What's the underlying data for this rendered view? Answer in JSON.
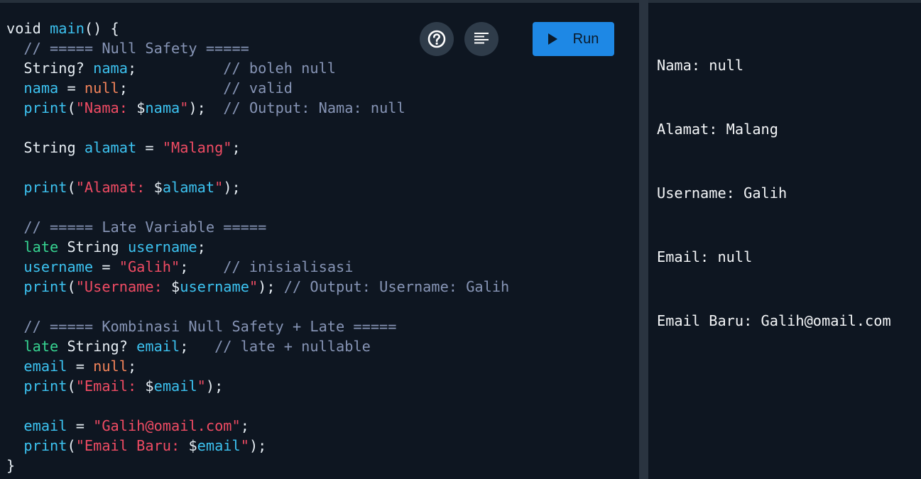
{
  "colors": {
    "background": "#0e1621",
    "keyword": "#e6edf3",
    "identifier": "#3cc2f0",
    "string": "#ef4b63",
    "null_literal": "#f2835a",
    "comment": "#8694b5",
    "late_keyword": "#36d391",
    "run_button": "#1e88e5",
    "icon_button": "#2f3c4a"
  },
  "toolbar": {
    "help_icon": "help-circle-icon",
    "format_icon": "format-align-left-icon",
    "run_label": "Run",
    "run_icon": "play-icon"
  },
  "code": {
    "l1": {
      "a": "void ",
      "b": "main",
      "c": "() {"
    },
    "l2": {
      "a": "  // ===== Null Safety ====="
    },
    "l3": {
      "a": "  String? ",
      "b": "nama",
      "c": ";          ",
      "d": "// boleh null"
    },
    "l4": {
      "a": "  ",
      "b": "nama",
      "c": " = ",
      "d": "null",
      "e": ";           ",
      "f": "// valid"
    },
    "l5": {
      "a": "  ",
      "b": "print",
      "c": "(",
      "d": "\"Nama: ",
      "e": "$",
      "f": "nama",
      "g": "\"",
      "h": ");  ",
      "i": "// Output: Nama: null"
    },
    "l6": {
      "a": ""
    },
    "l7": {
      "a": "  String ",
      "b": "alamat",
      "c": " = ",
      "d": "\"Malang\"",
      "e": ";"
    },
    "l8": {
      "a": ""
    },
    "l9": {
      "a": "  ",
      "b": "print",
      "c": "(",
      "d": "\"Alamat: ",
      "e": "$",
      "f": "alamat",
      "g": "\"",
      "h": ");"
    },
    "l10": {
      "a": ""
    },
    "l11": {
      "a": "  // ===== Late Variable ====="
    },
    "l12": {
      "a": "  ",
      "b": "late",
      "c": " String ",
      "d": "username",
      "e": ";"
    },
    "l13": {
      "a": "  ",
      "b": "username",
      "c": " = ",
      "d": "\"Galih\"",
      "e": ";    ",
      "f": "// inisialisasi"
    },
    "l14": {
      "a": "  ",
      "b": "print",
      "c": "(",
      "d": "\"Username: ",
      "e": "$",
      "f": "username",
      "g": "\"",
      "h": "); ",
      "i": "// Output: Username: Galih"
    },
    "l15": {
      "a": ""
    },
    "l16": {
      "a": "  // ===== Kombinasi Null Safety + Late ====="
    },
    "l17": {
      "a": "  ",
      "b": "late",
      "c": " String? ",
      "d": "email",
      "e": ";   ",
      "f": "// late + nullable"
    },
    "l18": {
      "a": "  ",
      "b": "email",
      "c": " = ",
      "d": "null",
      "e": ";"
    },
    "l19": {
      "a": "  ",
      "b": "print",
      "c": "(",
      "d": "\"Email: ",
      "e": "$",
      "f": "email",
      "g": "\"",
      "h": ");"
    },
    "l20": {
      "a": ""
    },
    "l21": {
      "a": "  ",
      "b": "email",
      "c": " = ",
      "d": "\"Galih@omail.com\"",
      "e": ";"
    },
    "l22": {
      "a": "  ",
      "b": "print",
      "c": "(",
      "d": "\"Email Baru: ",
      "e": "$",
      "f": "email",
      "g": "\"",
      "h": ");"
    },
    "l23": {
      "a": "}"
    }
  },
  "output": {
    "lines": [
      "Nama: null",
      "Alamat: Malang",
      "Username: Galih",
      "Email: null",
      "Email Baru: Galih@omail.com"
    ]
  }
}
